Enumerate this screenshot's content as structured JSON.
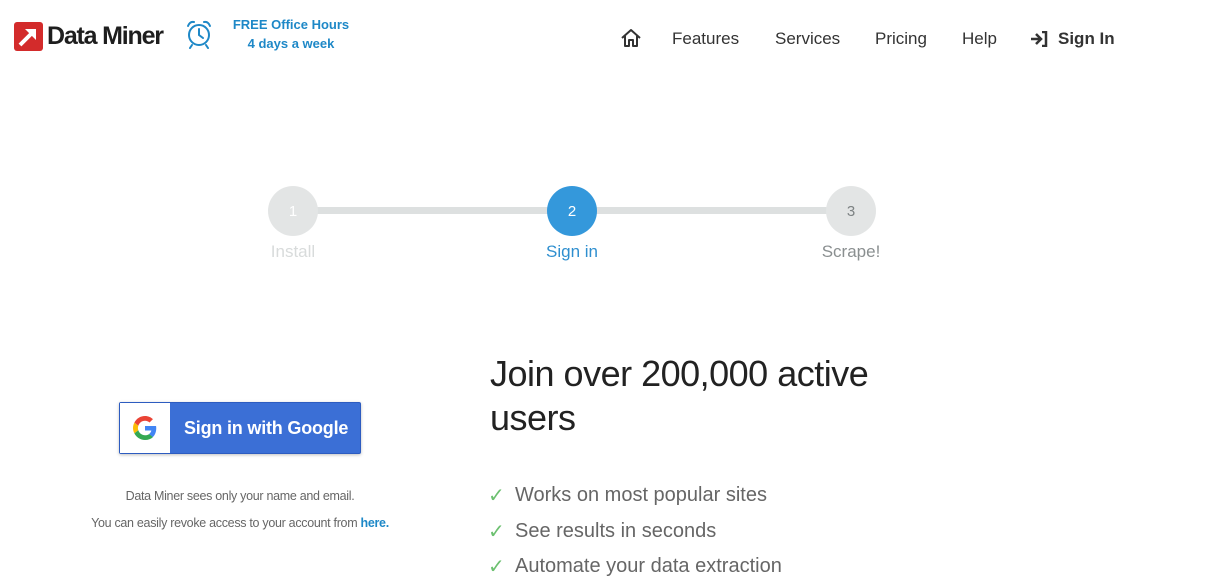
{
  "header": {
    "logo_text": "Data Miner",
    "office_hours_line1": "FREE Office Hours",
    "office_hours_line2": "4 days a week",
    "nav": {
      "features": "Features",
      "services": "Services",
      "pricing": "Pricing",
      "help": "Help",
      "sign_in": "Sign In"
    }
  },
  "stepper": {
    "steps": [
      {
        "number": "1",
        "label": "Install"
      },
      {
        "number": "2",
        "label": "Sign in"
      },
      {
        "number": "3",
        "label": "Scrape!"
      }
    ],
    "active_step": 2
  },
  "signin": {
    "google_button": "Sign in with Google",
    "note_line1": "Data Miner sees only your name and email.",
    "note_line2_prefix": "You can easily revoke access to your account from ",
    "note_line2_link": "here."
  },
  "promo": {
    "headline": "Join over 200,000 active users",
    "features": [
      "Works on most popular sites",
      "See results in seconds",
      "Automate your data extraction"
    ],
    "check_glyph": "✓"
  },
  "colors": {
    "brand_red": "#d32b2b",
    "accent_blue": "#3498db",
    "google_blue": "#3b6fd6",
    "link_blue": "#1e88c7",
    "check_green": "#6cc070"
  }
}
